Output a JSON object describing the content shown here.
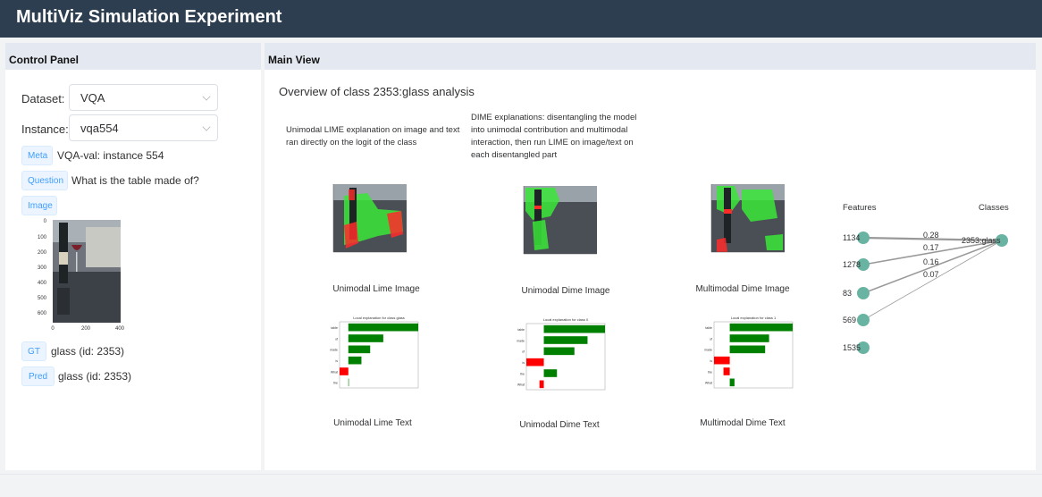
{
  "app": {
    "title": "MultiViz Simulation Experiment"
  },
  "control": {
    "header": "Control Panel",
    "dataset": {
      "label": "Dataset:",
      "value": "VQA"
    },
    "instance": {
      "label": "Instance:",
      "value": "vqa554"
    },
    "meta": {
      "tag": "Meta",
      "value": "VQA-val: instance 554"
    },
    "question": {
      "tag": "Question",
      "value": "What is the table made of?"
    },
    "image": {
      "tag": "Image",
      "y_ticks": [
        "0",
        "100",
        "200",
        "300",
        "400",
        "500",
        "600"
      ],
      "x_ticks": [
        "0",
        "200",
        "400"
      ]
    },
    "gt": {
      "tag": "GT",
      "value": "glass (id: 2353)"
    },
    "pred": {
      "tag": "Pred",
      "value": "glass (id: 2353)"
    }
  },
  "main": {
    "header": "Main View",
    "overview": "Overview of class 2353:glass analysis",
    "caption_unimodal": "Unimodal LIME explanation on image and text ran directly on the logit of the class",
    "caption_dime": "DIME explanations: disentangling the model into unimodal contribution and multimodal interaction, then run LIME on image/text on each disentangled part",
    "viz_labels": {
      "unimodal_lime_image": "Unimodal Lime Image",
      "unimodal_dime_image": "Unimodal Dime Image",
      "multimodal_dime_image": "Multimodal Dime Image",
      "unimodal_lime_text": "Unimodal Lime Text",
      "unimodal_dime_text": "Unimodal Dime Text",
      "multimodal_dime_text": "Multimodal Dime Text"
    },
    "text_charts": [
      {
        "title": "Local explanation for class glass",
        "words": [
          "table",
          "of",
          "made",
          "is",
          "What",
          "the"
        ],
        "weights": [
          8,
          4,
          2.5,
          1.5,
          -1,
          0
        ]
      },
      {
        "title": "Local explanation for class 0",
        "words": [
          "table",
          "made",
          "of",
          "is",
          "the",
          "What"
        ],
        "weights": [
          7,
          5,
          3.5,
          -2,
          1.5,
          -0.5
        ]
      },
      {
        "title": "Local explanation for class 1",
        "words": [
          "table",
          "of",
          "made",
          "is",
          "the",
          "What"
        ],
        "weights": [
          8,
          5,
          4.5,
          -2,
          -0.8,
          0.6
        ]
      }
    ],
    "graph": {
      "features_label": "Features",
      "classes_label": "Classes",
      "features": [
        "1134",
        "1278",
        "83",
        "569",
        "1535"
      ],
      "class": "2353:glass",
      "edge_weights": [
        "0.28",
        "0.17",
        "0.16",
        "0.07"
      ],
      "node_color": "#69b3a2"
    }
  }
}
